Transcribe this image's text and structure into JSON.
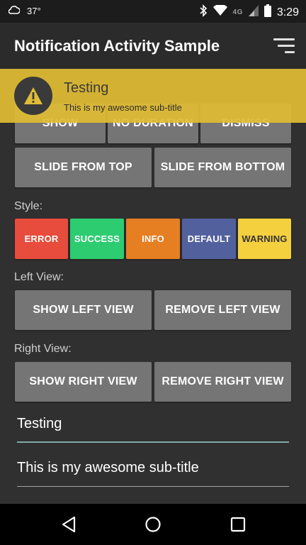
{
  "status_bar": {
    "temperature": "37°",
    "network": "4G",
    "time": "3:29",
    "icons": [
      "weather-icon",
      "bluetooth-icon",
      "wifi-icon",
      "signal-icon",
      "battery-icon"
    ]
  },
  "app_bar": {
    "title": "Notification Activity Sample",
    "menu_icon": "sort-menu-icon"
  },
  "actions": {
    "show_label": "SHOW",
    "no_duration_label": "NO DURATION",
    "dismiss_label": "DISMISS",
    "slide_top_label": "SLIDE FROM TOP",
    "slide_bottom_label": "SLIDE FROM BOTTOM"
  },
  "style_section": {
    "label": "Style:",
    "buttons": [
      {
        "label": "ERROR",
        "color": "#e74c3c"
      },
      {
        "label": "SUCCESS",
        "color": "#2ecc71"
      },
      {
        "label": "INFO",
        "color": "#e67e22"
      },
      {
        "label": "DEFAULT",
        "color": "#52619e"
      },
      {
        "label": "WARNING",
        "color": "#f4d03f"
      }
    ]
  },
  "left_view": {
    "label": "Left View:",
    "show_label": "SHOW LEFT VIEW",
    "remove_label": "REMOVE LEFT VIEW"
  },
  "right_view": {
    "label": "Right View:",
    "show_label": "SHOW RIGHT VIEW",
    "remove_label": "REMOVE RIGHT VIEW"
  },
  "inputs": {
    "title_value": "Testing",
    "subtitle_value": "This is my awesome sub-title"
  },
  "notification": {
    "title": "Testing",
    "subtitle": "This is my awesome sub-title",
    "icon": "warning-icon",
    "color": "#e0bc34"
  },
  "nav_bar": {
    "icons": [
      "back-icon",
      "home-icon",
      "recents-icon"
    ]
  }
}
